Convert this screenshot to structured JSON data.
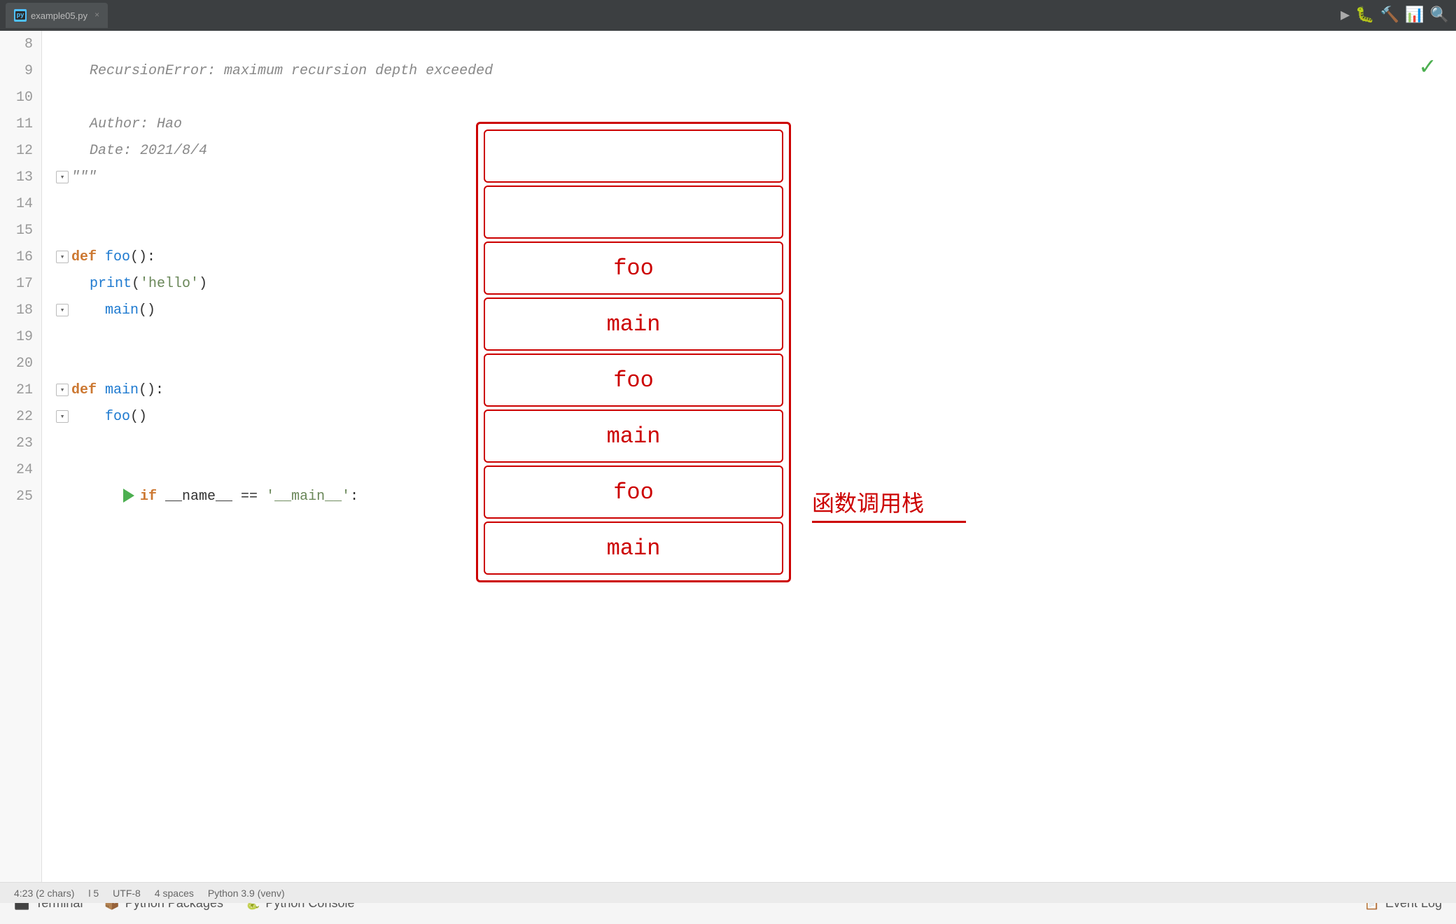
{
  "tab": {
    "icon_label": "py",
    "label": "example05.py",
    "close": "×"
  },
  "checkmark": "✓",
  "lines": [
    {
      "num": 8,
      "content": "",
      "type": "blank"
    },
    {
      "num": 9,
      "content": "    RecursionError: maximum recursion depth exceeded",
      "type": "comment"
    },
    {
      "num": 10,
      "content": "",
      "type": "blank"
    },
    {
      "num": 11,
      "content": "    Author: Hao",
      "type": "comment"
    },
    {
      "num": 12,
      "content": "    Date: 2021/8/4",
      "type": "comment"
    },
    {
      "num": 13,
      "content": "    \"\"\"",
      "type": "comment_fold"
    },
    {
      "num": 14,
      "content": "",
      "type": "blank"
    },
    {
      "num": 15,
      "content": "",
      "type": "blank"
    },
    {
      "num": 16,
      "content": "def foo():",
      "type": "def_foo",
      "fold": true
    },
    {
      "num": 17,
      "content": "    print('hello')",
      "type": "code"
    },
    {
      "num": 18,
      "content": "    main()",
      "type": "code_fold"
    },
    {
      "num": 19,
      "content": "",
      "type": "blank"
    },
    {
      "num": 20,
      "content": "",
      "type": "blank"
    },
    {
      "num": 21,
      "content": "def main():",
      "type": "def_main",
      "fold": true
    },
    {
      "num": 22,
      "content": "    foo()",
      "type": "code_fold"
    },
    {
      "num": 23,
      "content": "",
      "type": "blank"
    },
    {
      "num": 24,
      "content": "",
      "type": "blank"
    },
    {
      "num": 25,
      "content": "if __name__ == '__main__':",
      "type": "if",
      "run": true
    }
  ],
  "call_stack": {
    "frames": [
      {
        "label": "",
        "empty": true
      },
      {
        "label": "",
        "empty": true
      },
      {
        "label": "foo",
        "empty": false
      },
      {
        "label": "main",
        "empty": false
      },
      {
        "label": "foo",
        "empty": false
      },
      {
        "label": "main",
        "empty": false
      },
      {
        "label": "foo",
        "empty": false
      },
      {
        "label": "main",
        "empty": false
      }
    ]
  },
  "chinese_label": "函数调用栈",
  "bottom_bar": {
    "items": [
      {
        "icon": "⬛",
        "label": "Terminal"
      },
      {
        "icon": "📦",
        "label": "Python Packages"
      },
      {
        "icon": "🐍",
        "label": "Python Console"
      }
    ],
    "right_item": {
      "icon": "📋",
      "label": "Event Log"
    }
  },
  "status_bar": {
    "position": "4:23 (2 chars)",
    "line": "l 5",
    "encoding": "UTF-8",
    "spaces": "4 spaces",
    "python": "Python 3.9 (venv)"
  }
}
